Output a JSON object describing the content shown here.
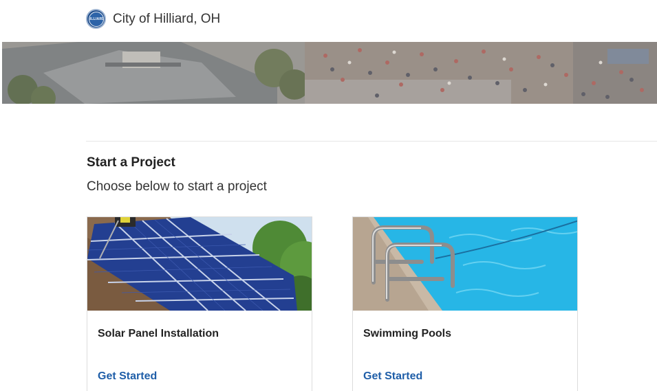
{
  "header": {
    "city_name": "City of Hilliard, OH",
    "logo_icon": "city-seal-icon",
    "seal_text": "HILLIARD"
  },
  "section": {
    "title": "Start a Project",
    "subtitle": "Choose below to start a project"
  },
  "cards": [
    {
      "title": "Solar Panel Installation",
      "link_label": "Get Started",
      "image": "solar-panels-on-roof"
    },
    {
      "title": "Swimming Pools",
      "link_label": "Get Started",
      "image": "swimming-pool-ladder"
    }
  ],
  "colors": {
    "link": "#1f5ea8",
    "text": "#222222",
    "divider": "#e6e6e6",
    "card_border": "#dcdcdc"
  }
}
